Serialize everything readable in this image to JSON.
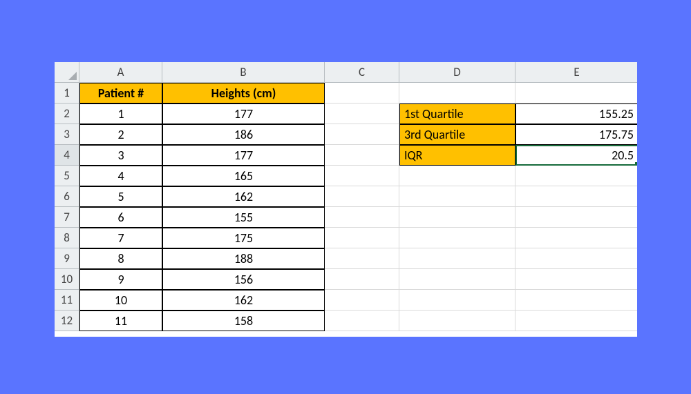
{
  "columns": {
    "A": "A",
    "B": "B",
    "C": "C",
    "D": "D",
    "E": "E"
  },
  "row_numbers": [
    "1",
    "2",
    "3",
    "4",
    "5",
    "6",
    "7",
    "8",
    "9",
    "10",
    "11",
    "12"
  ],
  "headers": {
    "col_a": "Patient #",
    "col_b": "Heights (cm)"
  },
  "data_rows": [
    {
      "patient": "1",
      "height": "177"
    },
    {
      "patient": "2",
      "height": "186"
    },
    {
      "patient": "3",
      "height": "177"
    },
    {
      "patient": "4",
      "height": "165"
    },
    {
      "patient": "5",
      "height": "162"
    },
    {
      "patient": "6",
      "height": "155"
    },
    {
      "patient": "7",
      "height": "175"
    },
    {
      "patient": "8",
      "height": "188"
    },
    {
      "patient": "9",
      "height": "156"
    },
    {
      "patient": "10",
      "height": "162"
    },
    {
      "patient": "11",
      "height": "158"
    }
  ],
  "stats": {
    "q1_label": "1st Quartile",
    "q1_value": "155.25",
    "q3_label": "3rd Quartile",
    "q3_value": "175.75",
    "iqr_label": "IQR",
    "iqr_value": "20.5"
  },
  "colors": {
    "page_bg": "#5a74ff",
    "highlight": "#ffc000",
    "selection": "#166a3a"
  },
  "selected_cell": "E4"
}
